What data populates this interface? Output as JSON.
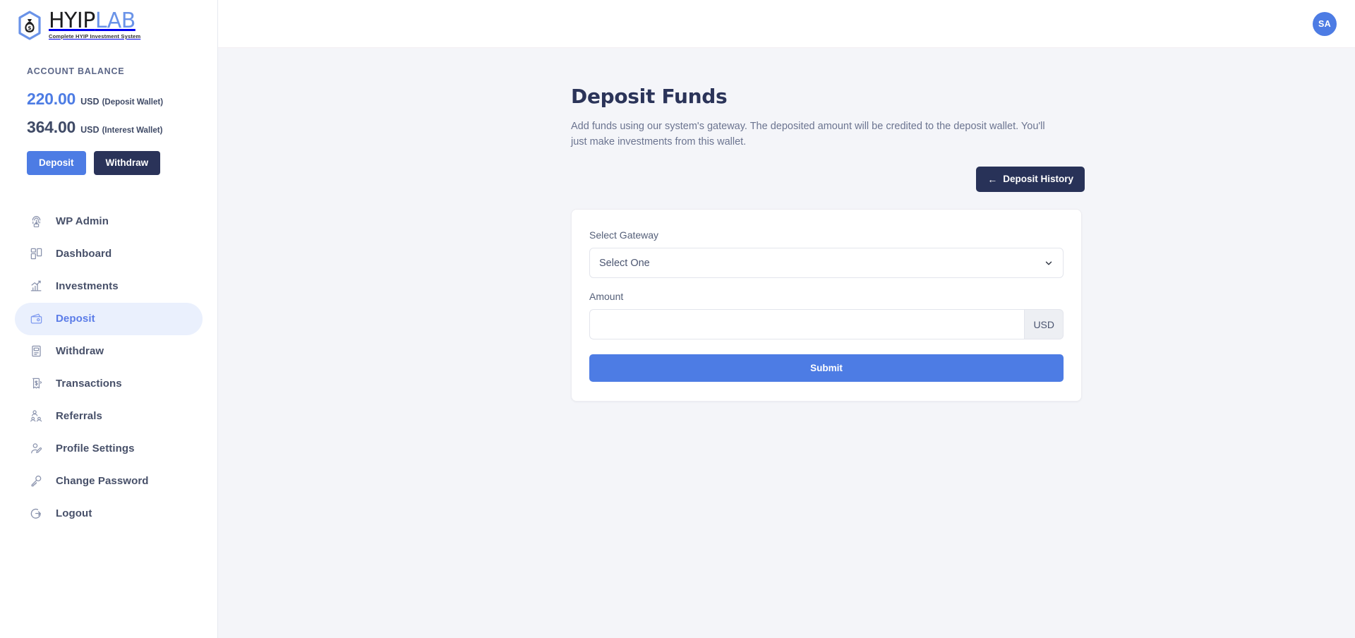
{
  "brand": {
    "name_primary": "HYIP",
    "name_secondary": "LAB",
    "tagline": "Complete HYIP Investment System",
    "mark_icon": "money-bag-hexagon-icon",
    "color_primary": "#1d1d1f",
    "color_secondary": "#6a93e8"
  },
  "sidebar": {
    "balance": {
      "label": "ACCOUNT BALANCE",
      "deposit": {
        "amount": "220.00",
        "currency": "USD",
        "wallet": "(Deposit Wallet)",
        "color": "#4d7ce4"
      },
      "interest": {
        "amount": "364.00",
        "currency": "USD",
        "wallet": "(Interest Wallet)",
        "color": "#3f4a66"
      },
      "deposit_button": "Deposit",
      "withdraw_button": "Withdraw",
      "deposit_button_color": "#4d7ce4",
      "withdraw_button_color": "#2a3359"
    },
    "nav": [
      {
        "label": "WP Admin",
        "icon": "fingerprint-icon",
        "active": false
      },
      {
        "label": "Dashboard",
        "icon": "grid-layout-icon",
        "active": false
      },
      {
        "label": "Investments",
        "icon": "bar-chart-icon",
        "active": false
      },
      {
        "label": "Deposit",
        "icon": "wallet-icon",
        "active": true
      },
      {
        "label": "Withdraw",
        "icon": "atm-machine-icon",
        "active": false
      },
      {
        "label": "Transactions",
        "icon": "receipt-money-icon",
        "active": false
      },
      {
        "label": "Referrals",
        "icon": "people-network-icon",
        "active": false
      },
      {
        "label": "Profile Settings",
        "icon": "user-edit-icon",
        "active": false
      },
      {
        "label": "Change Password",
        "icon": "key-icon",
        "active": false
      },
      {
        "label": "Logout",
        "icon": "logout-icon",
        "active": false
      }
    ],
    "active_pill_color": "#eaf0fd"
  },
  "topbar": {
    "avatar_initials": "SA",
    "avatar_color": "#4d7ce4"
  },
  "page": {
    "title": "Deposit Funds",
    "description": "Add funds using our system's gateway. The deposited amount will be credited to the deposit wallet. You'll just make investments from this wallet.",
    "history_button": {
      "label": "Deposit History",
      "arrow": "←",
      "icon": "arrow-left-icon",
      "color": "#283258"
    }
  },
  "form": {
    "gateway": {
      "label": "Select Gateway",
      "selected": "Select One",
      "options": [
        "Select One"
      ],
      "chevron_icon": "chevron-down-icon"
    },
    "amount": {
      "label": "Amount",
      "value": "",
      "placeholder": "",
      "currency_addon": "USD"
    },
    "submit_label": "Submit",
    "submit_color": "#4d7ce4"
  }
}
